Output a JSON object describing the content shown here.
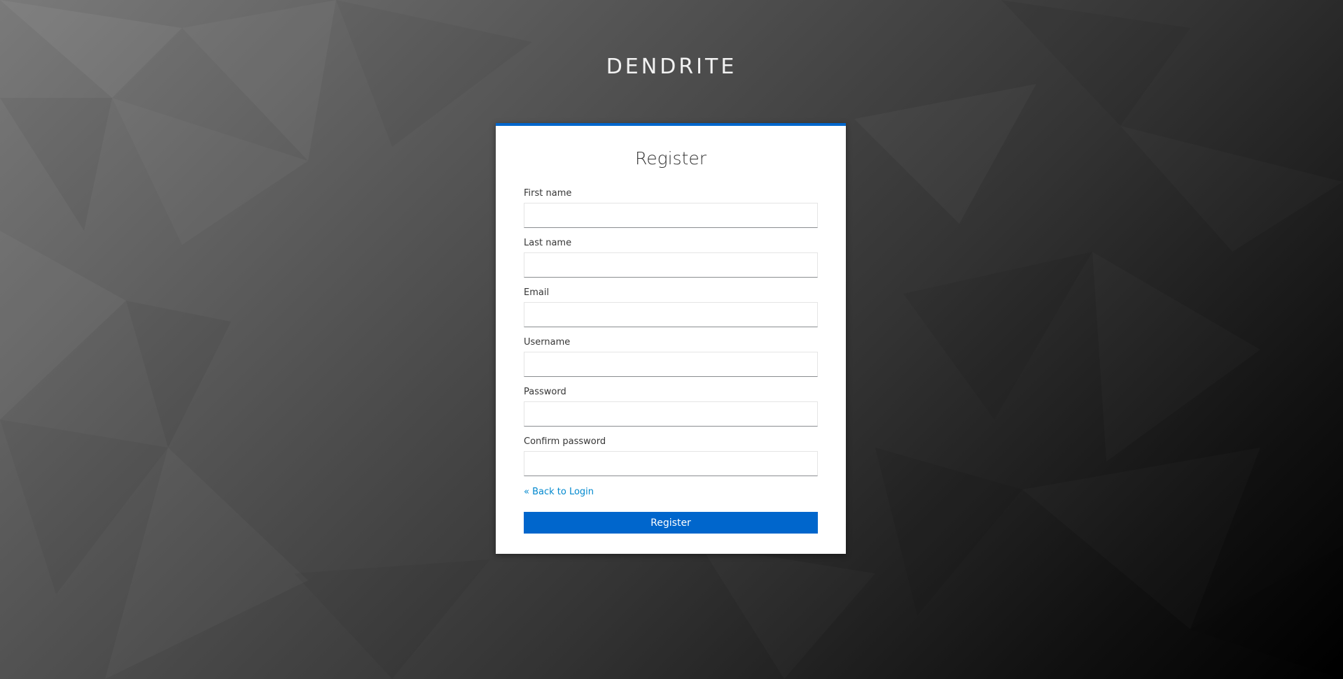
{
  "brand": {
    "name": "DENDRITE"
  },
  "form": {
    "title": "Register",
    "fields": [
      {
        "label": "First name",
        "value": ""
      },
      {
        "label": "Last name",
        "value": ""
      },
      {
        "label": "Email",
        "value": ""
      },
      {
        "label": "Username",
        "value": ""
      },
      {
        "label": "Password",
        "value": ""
      },
      {
        "label": "Confirm password",
        "value": ""
      }
    ],
    "back_link": "« Back to Login",
    "submit_label": "Register"
  },
  "colors": {
    "accent": "#0066cc",
    "link": "#0088ce",
    "card_background": "#ffffff"
  }
}
